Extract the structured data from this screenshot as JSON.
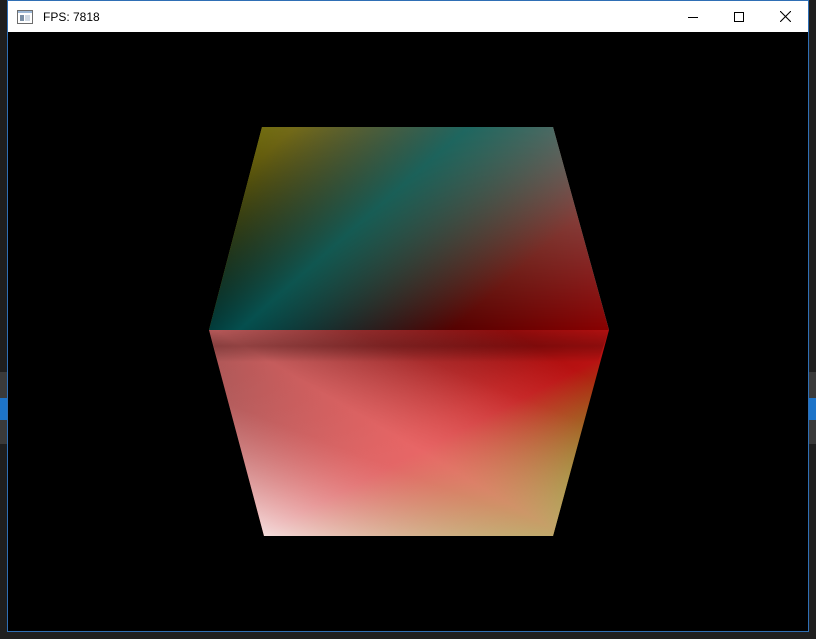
{
  "window": {
    "title": "FPS: 7818",
    "app_icon": "window-app-icon",
    "controls": [
      {
        "name": "minimize",
        "icon": "minimize-icon"
      },
      {
        "name": "maximize",
        "icon": "maximize-icon"
      },
      {
        "name": "close",
        "icon": "close-icon"
      }
    ]
  },
  "scene": {
    "background": "#000000",
    "object": "rgb-color-cube",
    "vertex_colors": {
      "top_left": "#ffff00",
      "top_right": "#00ffff",
      "right": "#ff0000",
      "left": "#000000",
      "bottom_left": "#ffffff",
      "bottom_right": "#00ff00",
      "center_top": "#008080",
      "center_bottom": "#ff8080"
    }
  }
}
